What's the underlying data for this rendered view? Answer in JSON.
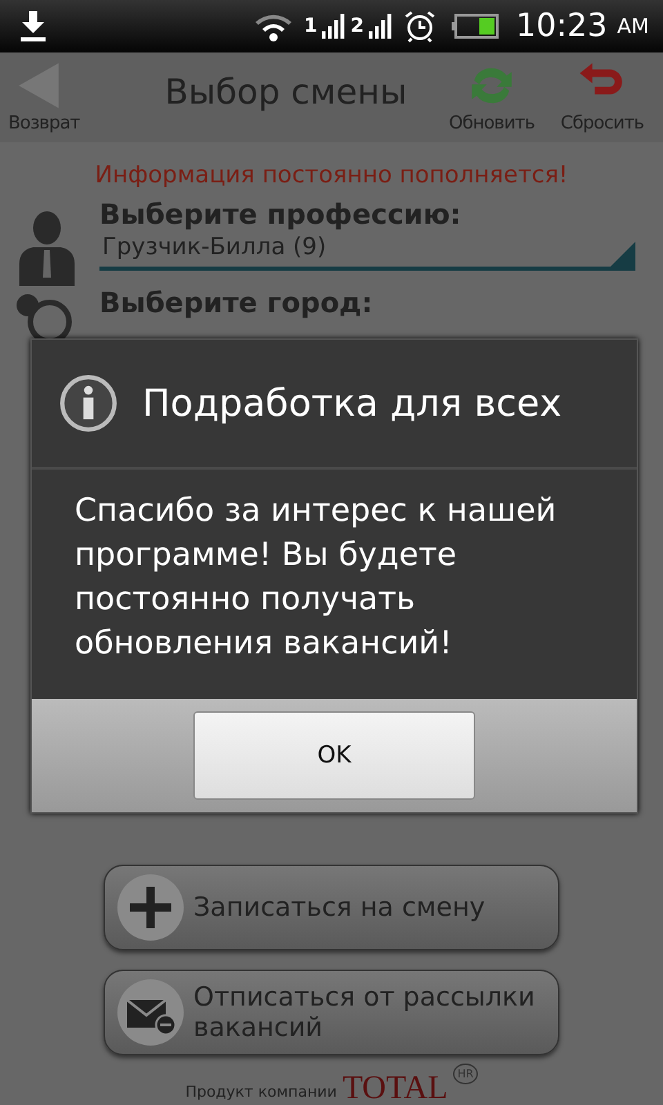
{
  "status_bar": {
    "sims": [
      "1",
      "2"
    ],
    "time": "10:23",
    "ampm": "AM"
  },
  "toolbar": {
    "back": "Возврат",
    "title": "Выбор смены",
    "refresh": "Обновить",
    "reset": "Сбросить"
  },
  "notice": "Информация постоянно пополняется!",
  "fields": [
    {
      "label": "Выберите профессию:",
      "value": "Грузчик-Билла (9)"
    },
    {
      "label": "Выберите город:"
    }
  ],
  "actions": [
    {
      "label": "Записаться на смену"
    },
    {
      "label": "Отписаться от рассылки вакансий"
    }
  ],
  "footer": {
    "text": "Продукт компании",
    "brand": "TOTAL",
    "badge": "HR"
  },
  "dialog": {
    "title": "Подработка для всех",
    "message": "Спасибо за интерес к нашей программе! Вы будете постоянно получать обновления вакансий!",
    "button": "OK"
  }
}
